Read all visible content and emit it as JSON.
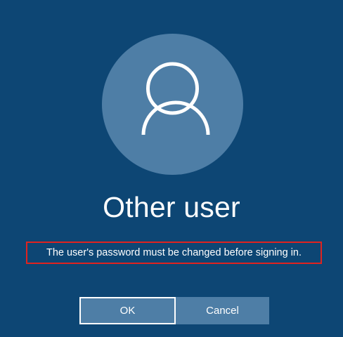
{
  "user": {
    "display_name": "Other user",
    "avatar_icon": "user-silhouette-icon"
  },
  "status": {
    "message": "The user's password must be changed before signing in."
  },
  "actions": {
    "ok_label": "OK",
    "cancel_label": "Cancel"
  },
  "colors": {
    "background": "#0d4674",
    "avatar_bg": "#4e7ea6",
    "button_bg": "#4e7ea6",
    "highlight_border": "#e0231f",
    "text": "#ffffff"
  }
}
